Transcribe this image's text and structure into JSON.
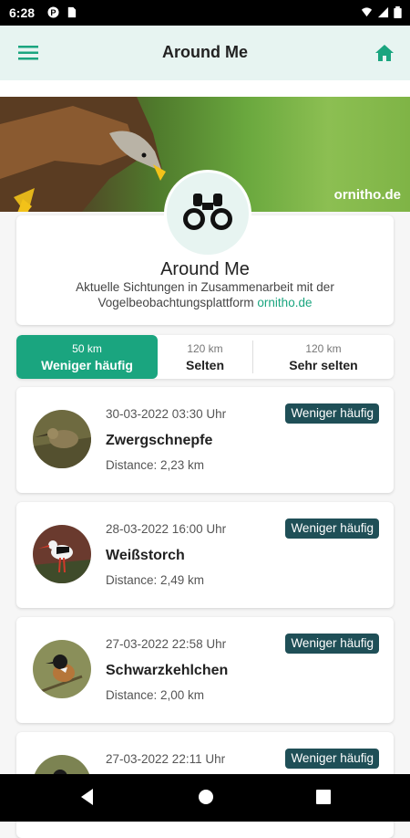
{
  "status_bar": {
    "time": "6:28"
  },
  "app_bar": {
    "title": "Around Me"
  },
  "banner": {
    "brand": "ornitho.de"
  },
  "header": {
    "title": "Around Me",
    "description": "Aktuelle Sichtungen in Zusammenarbeit mit der Vogelbeobachtungsplattform",
    "link": "ornitho.de"
  },
  "tabs": [
    {
      "distance": "50 km",
      "label": "Weniger häufig"
    },
    {
      "distance": "120 km",
      "label": "Selten"
    },
    {
      "distance": "120 km",
      "label": "Sehr selten"
    }
  ],
  "sightings": [
    {
      "date": "30-03-2022 03:30 Uhr",
      "name": "Zwergschnepfe",
      "distance": "Distance: 2,23 km",
      "badge": "Weniger häufig"
    },
    {
      "date": "28-03-2022 16:00 Uhr",
      "name": "Weißstorch",
      "distance": "Distance: 2,49 km",
      "badge": "Weniger häufig"
    },
    {
      "date": "27-03-2022 22:58 Uhr",
      "name": "Schwarzkehlchen",
      "distance": "Distance: 2,00 km",
      "badge": "Weniger häufig"
    },
    {
      "date": "27-03-2022 22:11 Uhr",
      "badge": "Weniger häufig"
    }
  ],
  "colors": {
    "accent": "#1aa57f",
    "badge": "#1f4f57",
    "app_bar_bg": "#e7f4f1"
  },
  "icons": {
    "menu": "hamburger-icon",
    "home": "home-icon",
    "logo": "binoculars-icon"
  }
}
